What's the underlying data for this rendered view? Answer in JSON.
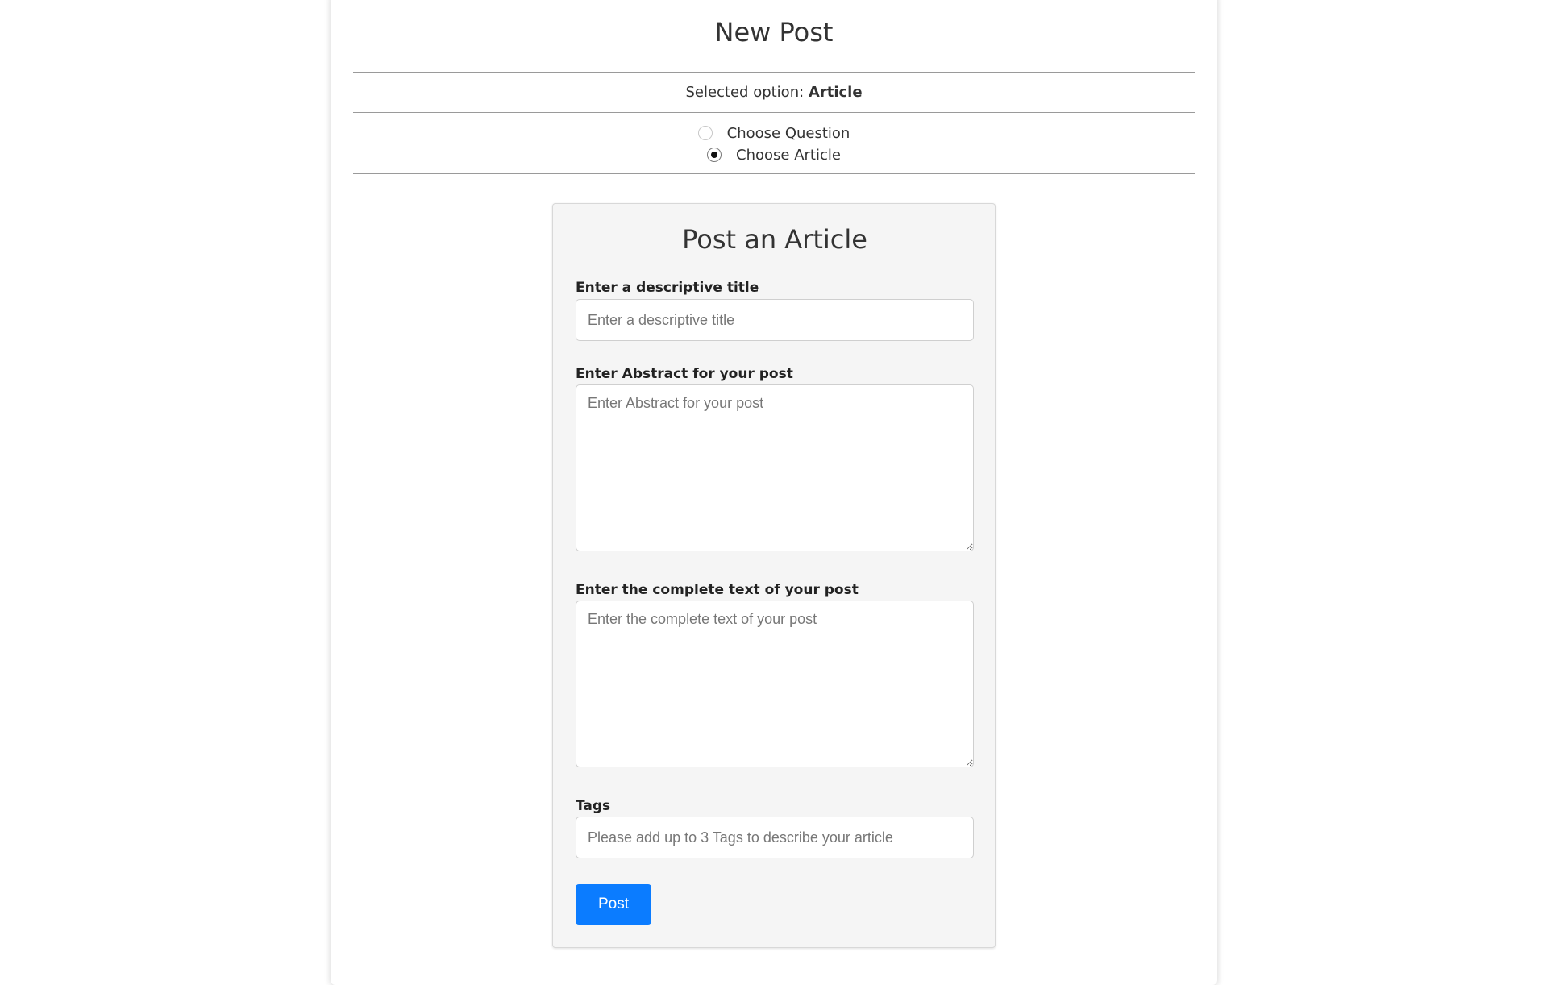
{
  "page": {
    "title": "New Post",
    "selected_prefix": "Selected option: ",
    "selected_value": "Article"
  },
  "options": {
    "question_label": "Choose Question",
    "article_label": "Choose Article",
    "selected": "article"
  },
  "form": {
    "title": "Post an Article",
    "title_field": {
      "label": "Enter a descriptive title",
      "placeholder": "Enter a descriptive title",
      "value": ""
    },
    "abstract_field": {
      "label": "Enter Abstract for your post",
      "placeholder": "Enter Abstract for your post",
      "value": ""
    },
    "body_field": {
      "label": "Enter the complete text of your post",
      "placeholder": "Enter the complete text of your post",
      "value": ""
    },
    "tags_field": {
      "label": "Tags",
      "placeholder": "Please add up to 3 Tags to describe your article",
      "value": ""
    },
    "submit_label": "Post"
  },
  "colors": {
    "accent": "#0b7cff",
    "form_background": "#f5f5f5",
    "divider": "#9a9a9a"
  }
}
